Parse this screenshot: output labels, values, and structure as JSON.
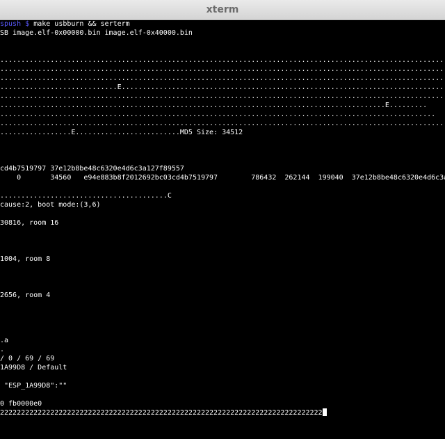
{
  "window": {
    "title": "xterm"
  },
  "prompt": {
    "host": "spush",
    "symbol": "$",
    "command": "make usbburn && serterm"
  },
  "lines": [
    "SB image.elf-0x00000.bin image.elf-0x40000.bin",
    "",
    "",
    "...........................................................................................................E.",
    "................................................................................................................",
    "...............................................................................................................",
    "............................E.....................................................................................",
    "..............................................................................................................",
    "............................................................................................E.........",
    "........................................................................................................",
    "................................................................................................................",
    ".................E.........................MD5 Size: 34512",
    "",
    "",
    "",
    "cd4b7519797 37e12b8be48c6320e4d6c3a127f89557",
    "    0       34560   e94e883b8f2012692bc03cd4b7519797        786432  262144  199040  37e12b8be48c6320e4d6c3a1",
    "",
    "........................................C",
    "cause:2, boot mode:(3,6)",
    "",
    "30816, room 16",
    "",
    "",
    "",
    "1004, room 8",
    "",
    "",
    "",
    "2656, room 4",
    "",
    "",
    "",
    "",
    ".a",
    ".",
    "/ 0 / 69 / 69",
    "1A99D8 / Default",
    "",
    " \"ESP_1A99D8\":\"\"",
    "",
    "0 fb0000e0",
    "22222222222222222222222222222222222222222222222222222222222222222222222222222"
  ]
}
